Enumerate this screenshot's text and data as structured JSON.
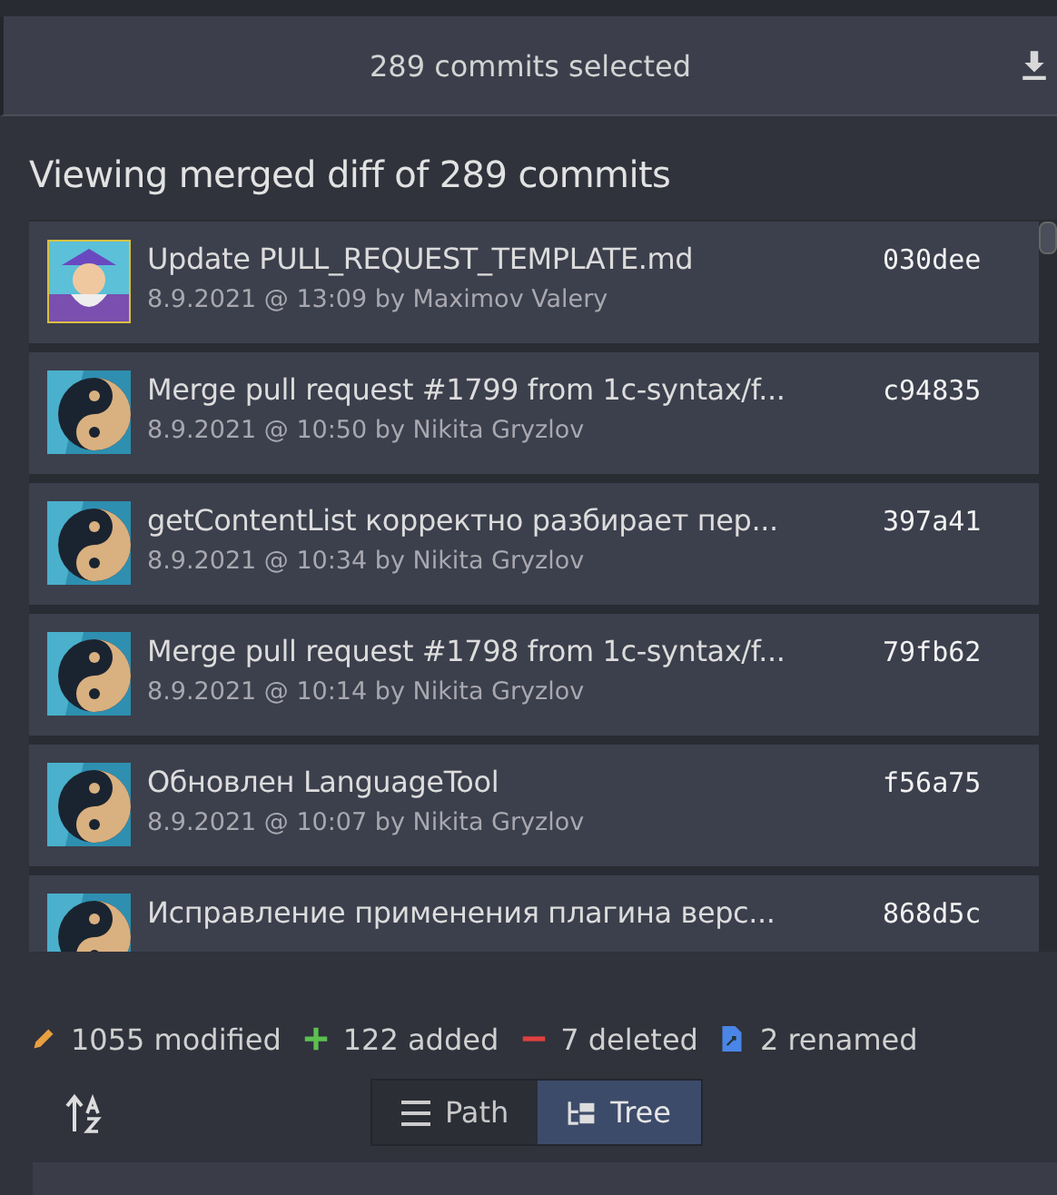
{
  "header": {
    "title": "289 commits selected"
  },
  "heading": "Viewing merged diff of 289 commits",
  "commits": [
    {
      "summary": "Update PULL_REQUEST_TEMPLATE.md",
      "meta": "8.9.2021 @ 13:09 by Maximov Valery",
      "sha": "030dee"
    },
    {
      "summary": "Merge pull request #1799 from 1c-syntax/f...",
      "meta": "8.9.2021 @ 10:50 by Nikita Gryzlov",
      "sha": "c94835"
    },
    {
      "summary": "getContentList корректно разбирает пер...",
      "meta": "8.9.2021 @ 10:34 by Nikita Gryzlov",
      "sha": "397a41"
    },
    {
      "summary": "Merge pull request #1798 from 1c-syntax/f...",
      "meta": "8.9.2021 @ 10:14 by Nikita Gryzlov",
      "sha": "79fb62"
    },
    {
      "summary": "Обновлен LanguageTool",
      "meta": "8.9.2021 @ 10:07 by Nikita Gryzlov",
      "sha": "f56a75"
    },
    {
      "summary": "Исправление применения плагина верс...",
      "sha": "868d5c"
    }
  ],
  "stats": [
    {
      "kind": "modified",
      "label": "1055 modified"
    },
    {
      "kind": "added",
      "label": "122 added"
    },
    {
      "kind": "deleted",
      "label": "7 deleted"
    },
    {
      "kind": "renamed",
      "label": "2 renamed"
    }
  ],
  "view_modes": [
    {
      "kind": "path",
      "label": "Path",
      "selected": false
    },
    {
      "kind": "tree",
      "label": "Tree",
      "selected": true
    }
  ]
}
